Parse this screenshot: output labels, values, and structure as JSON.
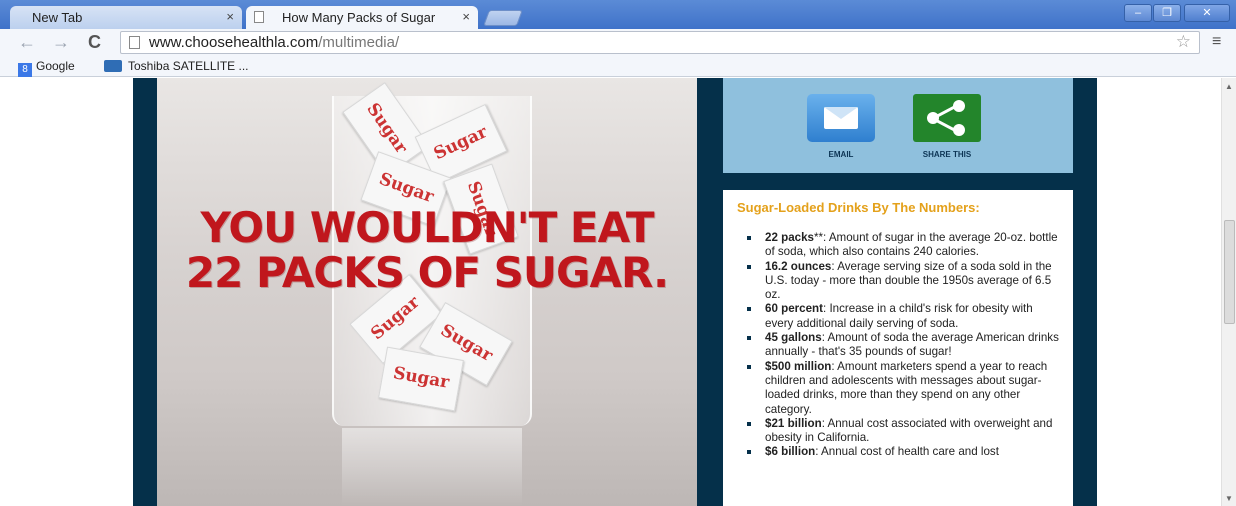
{
  "browser": {
    "tabs": [
      {
        "title": "New Tab"
      },
      {
        "title": "How Many Packs of Sugar"
      }
    ],
    "tab_close_glyph": "×",
    "window_buttons": {
      "minimize": "–",
      "restore": "❐",
      "close": "✕"
    },
    "url": {
      "host": "www.choosehealthla.com",
      "path": "/multimedia/"
    },
    "nav": {
      "back": "←",
      "forward": "→",
      "reload": "C"
    },
    "star_glyph": "☆",
    "menu_glyph": "≡",
    "bookmarks": [
      {
        "label": "Google",
        "icon": "google-icon",
        "icon_letter": "8"
      },
      {
        "label": "Toshiba SATELLITE ...",
        "icon": "toshiba-icon"
      }
    ]
  },
  "hero": {
    "headline_line1": "YOU WOULDN'T EAT",
    "headline_line2": "22 PACKS OF SUGAR.",
    "packet_text": "Sugar"
  },
  "share": {
    "email_label": "EMAIL",
    "share_label": "SHARE THIS"
  },
  "numbers": {
    "title": "Sugar-Loaded Drinks By The Numbers:",
    "facts": [
      {
        "bold": "22 packs",
        "text": "**: Amount of sugar in the average 20-oz. bottle of soda, which also contains 240 calories."
      },
      {
        "bold": "16.2 ounces",
        "text": ": Average serving size of a soda sold in the U.S. today - more than double the 1950s average of 6.5 oz."
      },
      {
        "bold": "60 percent",
        "text": ": Increase in a child's risk for obesity with every additional daily serving of soda."
      },
      {
        "bold": "45 gallons",
        "text": ": Amount of soda the average American drinks annually - that's 35 pounds of sugar!"
      },
      {
        "bold": "$500 million",
        "text": ": Amount marketers spend a year to reach children and adolescents with messages about sugar-loaded drinks, more than they spend on any other category."
      },
      {
        "bold": "$21 billion",
        "text": ": Annual cost associated with overweight and obesity in California."
      },
      {
        "bold": "$6 billion",
        "text": ": Annual cost of health care and lost"
      }
    ]
  },
  "colors": {
    "site_frame": "#05304a",
    "share_panel": "#8fc0dd",
    "headline": "#c0171d",
    "numbers_title": "#e4a11b"
  }
}
